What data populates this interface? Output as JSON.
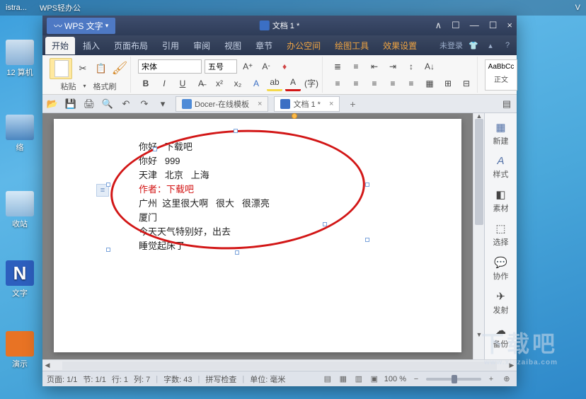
{
  "taskbar": {
    "item1": "istra...",
    "item2": "WPS轻办公",
    "right": "V"
  },
  "desktop": {
    "d1": "12\n算机",
    "d2": "络",
    "d3": "收站",
    "d4": "文字",
    "d4_badge": "N",
    "d5": "演示"
  },
  "titlebar": {
    "app": "WPS 文字",
    "doc": "文档 1 *",
    "min": "—",
    "max": "☐",
    "close": "×",
    "more1": "∧",
    "more2": "☐"
  },
  "menu": {
    "tabs": [
      "开始",
      "插入",
      "页面布局",
      "引用",
      "审阅",
      "视图",
      "章节",
      "办公空间",
      "绘图工具",
      "效果设置"
    ],
    "login": "未登录"
  },
  "ribbon": {
    "paste": "粘贴",
    "format": "格式刷",
    "font": "宋体",
    "fontsize": "五号",
    "style_preview": "AaBbCc",
    "style_name": "正文"
  },
  "quickbar": {
    "tab1": "Docer-在线模板",
    "tab2": "文档 1 *"
  },
  "document": {
    "lines": [
      "你好   下载吧",
      "你好   999",
      "天津   北京   上海",
      "作者：下载吧",
      "广州  这里很大啊   很大   很漂亮",
      "厦门",
      "今天天气特别好，出去",
      "睡觉起床了"
    ]
  },
  "sidebar": {
    "items": [
      "新建",
      "样式",
      "素材",
      "选择",
      "协作",
      "发射",
      "备份"
    ]
  },
  "status": {
    "page": "页面: 1/1",
    "section": "节: 1/1",
    "line": "行: 1",
    "col": "列: 7",
    "words": "字数: 43",
    "spell": "拼写检查",
    "unit": "单位: 毫米",
    "zoom": "100 %"
  },
  "watermark": {
    "text": "下载吧",
    "sub": "www.xiazaiba.com"
  }
}
